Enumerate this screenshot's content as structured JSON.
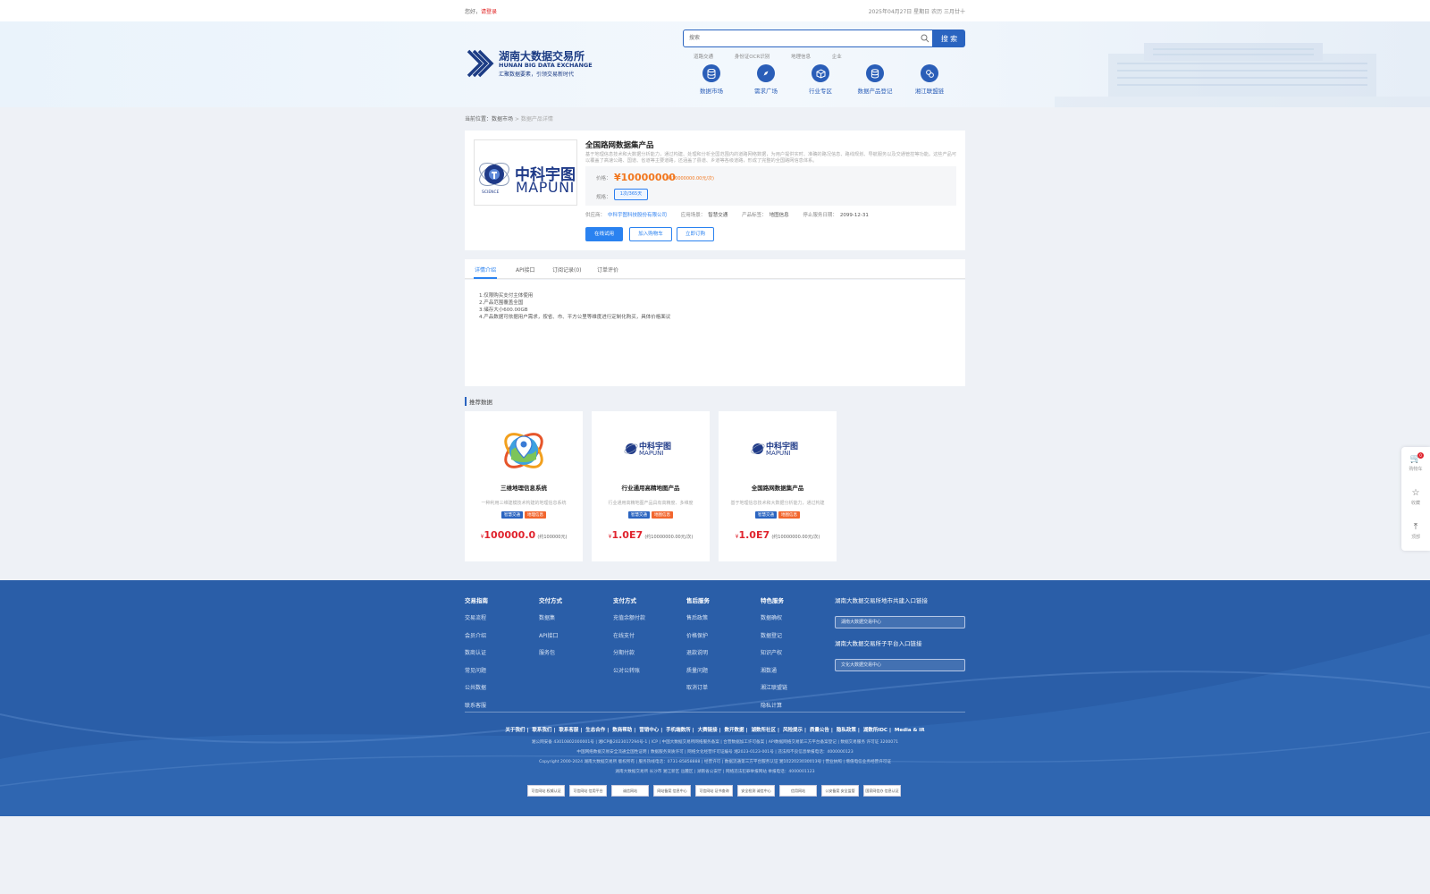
{
  "topbar": {
    "greeting": "您好，",
    "login": "请登录",
    "date": "2025年04月27日 星期日  农历 三月廿十"
  },
  "header": {
    "logo_cn": "湖南大数据交易所",
    "logo_en": "HUNAN BIG DATA EXCHANGE",
    "logo_slogan": "汇聚数据要素，引领交易新时代",
    "search_placeholder": "搜索",
    "search_button": "搜 索",
    "hotwords": [
      "道路交通",
      "身份证OCR识别",
      "地理信息",
      "企业"
    ],
    "nav": [
      {
        "label": "数据市场",
        "icon": "database-icon"
      },
      {
        "label": "需求广场",
        "icon": "compass-icon"
      },
      {
        "label": "行业专区",
        "icon": "cube-icon"
      },
      {
        "label": "数据产品登记",
        "icon": "register-icon"
      },
      {
        "label": "湘江联盟链",
        "icon": "chain-icon"
      }
    ]
  },
  "breadcrumb": {
    "prefix": "当前位置：",
    "market": "数据市场",
    "sep": " > ",
    "current": "数据产品详情"
  },
  "product": {
    "logo_cn": "中科宇图",
    "logo_en": "MAPUNI",
    "logo_ring": "SCIENCE",
    "title": "全国路网数据集产品",
    "description": "基于地理信息技术和大数据分析能力，通过构建、处理和分析全国范围内的道路网络数据，为用户提供实时、准确的路况信息、路线规划、导航服务以及交通管控等功能。这些产品可以覆盖了高速公路、国道、省道等主要道路，还涵盖了县道、乡道等各级道路，形成了完整的全国路网信息体系。",
    "price_label": "价格：",
    "price": "¥10000000",
    "price_approx": "(约10000000.00元/次)",
    "spec_label": "规格：",
    "spec": "1次/365天",
    "supplier_label": "供应商：",
    "supplier": "中科宇图科技股份有限公司",
    "scene_label": "应用场景：",
    "scene": "智慧交通",
    "tag_label": "产品标签：",
    "tag": "地图信息",
    "expire_label": "停止服务日期：",
    "expire": "2099-12-31",
    "btn_trial": "在线试用",
    "btn_cart": "加入购物车",
    "btn_order": "立即订购"
  },
  "tabs": [
    {
      "label": "详情介绍",
      "active": true
    },
    {
      "label": "API接口",
      "active": false
    },
    {
      "label": "订阅记录(0)",
      "active": false
    },
    {
      "label": "订单评价",
      "active": false
    }
  ],
  "detail_lines": [
    "1.仅限购买支付主体使用",
    "2.产品范围覆盖全国",
    "3.储存大小600.00GB",
    "4.产品数据可依据用户需求，按省、市、平方公里等维度进行定制化购买，具体价格面议"
  ],
  "recommend": {
    "title": "推荐数据",
    "cards": [
      {
        "name": "三维地理信息系统",
        "desc": "一种利用三维建模技术构建的地理信息系统",
        "tag1": "智慧交通",
        "tag2": "地理信息",
        "price": "100000.0",
        "approx": "(约100000元)",
        "logo": "map-pin-globe-icon"
      },
      {
        "name": "行业通用高精地图产品",
        "desc": "行业通用高精地图产品具有高精度、多维度",
        "tag1": "智慧交通",
        "tag2": "地图信息",
        "price": "1.0E7",
        "approx": "(约10000000.00元/次)",
        "logo": "mapuni-logo-icon"
      },
      {
        "name": "全国路网数据集产品",
        "desc": "基于地理信息技术和大数据分析能力，通过构建",
        "tag1": "智慧交通",
        "tag2": "地图信息",
        "price": "1.0E7",
        "approx": "(约10000000.00元/次)",
        "logo": "mapuni-logo-icon"
      }
    ],
    "currency": "¥",
    "logo_cn": "中科宇图",
    "logo_en": "MAPUNI"
  },
  "sidefloat": {
    "cart": "购物车",
    "cart_count": "0",
    "fav": "收藏",
    "top": "顶部"
  },
  "footer": {
    "cols": [
      {
        "title": "交易指南",
        "items": [
          "交易流程",
          "会员介绍",
          "数商认证",
          "常见问题",
          "公共数据",
          "联系客服"
        ]
      },
      {
        "title": "交付方式",
        "items": [
          "数据集",
          "API接口",
          "服务包"
        ]
      },
      {
        "title": "支付方式",
        "items": [
          "充值余额付款",
          "在线支付",
          "分期付款",
          "公对公转账"
        ]
      },
      {
        "title": "售后服务",
        "items": [
          "售后政策",
          "价格保护",
          "退款说明",
          "质量问题",
          "取消订单"
        ]
      },
      {
        "title": "特色服务",
        "items": [
          "数据确权",
          "数据登记",
          "知识产权",
          "湘数通",
          "湘江联盟链",
          "隐私计算"
        ]
      }
    ],
    "right_title1": "湖南大数据交易所地市共建入口链接",
    "right_select1": "湖南大数据交易中心",
    "right_title2": "湖南大数据交易所子平台入口链接",
    "right_select2": "文化大数据交易中心",
    "links": [
      "关于我们",
      "联系我们",
      "联系客服",
      "生态合作",
      "数商帮助",
      "营销中心",
      "手机端数所",
      "大赛链接",
      "数开数据",
      "湖数所社区",
      "风险提示",
      "质量公告",
      "隐私政策",
      "湖数所IDC",
      "Media & IR"
    ],
    "info1": "湘公网安备 43010802000001号  |  湘ICP备2023017294号-1  |  ICP  |  中国大数据交易所网络服务备案  |  合营数据加工许可备案  |  API数据网络交易第三方平台备案登记  |  数据交易服务 许可证 3200071",
    "info2": "中国网络数据交易安全流通全国性证明  |  数据服务资质许可  |  网络文化经营许可证编号 湘2023-0123-001号  |  违法和不良信息举报电话：4000000123",
    "info3": "Copyright 2000-2024  湖南大数据交易所 版权所有  |  服务热线电话：0731-85858888  |  经营许可  |  数据流通第三方平台服务认证 湘1022023030013号  |  营业执照  |  增值电信业务经营许可证",
    "info4": "湖南大数据交易所 长沙市 湘江新区 岳麓区  |  湖南省公安厅  |  网络违法犯罪举报网站 举报电话：4000001123",
    "badges": [
      "可信网站 权威认证",
      "可信网站 信用平台",
      "诚信网站",
      "网站备案 信息中心",
      "可信网站 证书查询",
      "安全检测 诚信中心",
      "信用网站",
      "公安备案 安全监管",
      "国家网信办 信息认证"
    ]
  }
}
